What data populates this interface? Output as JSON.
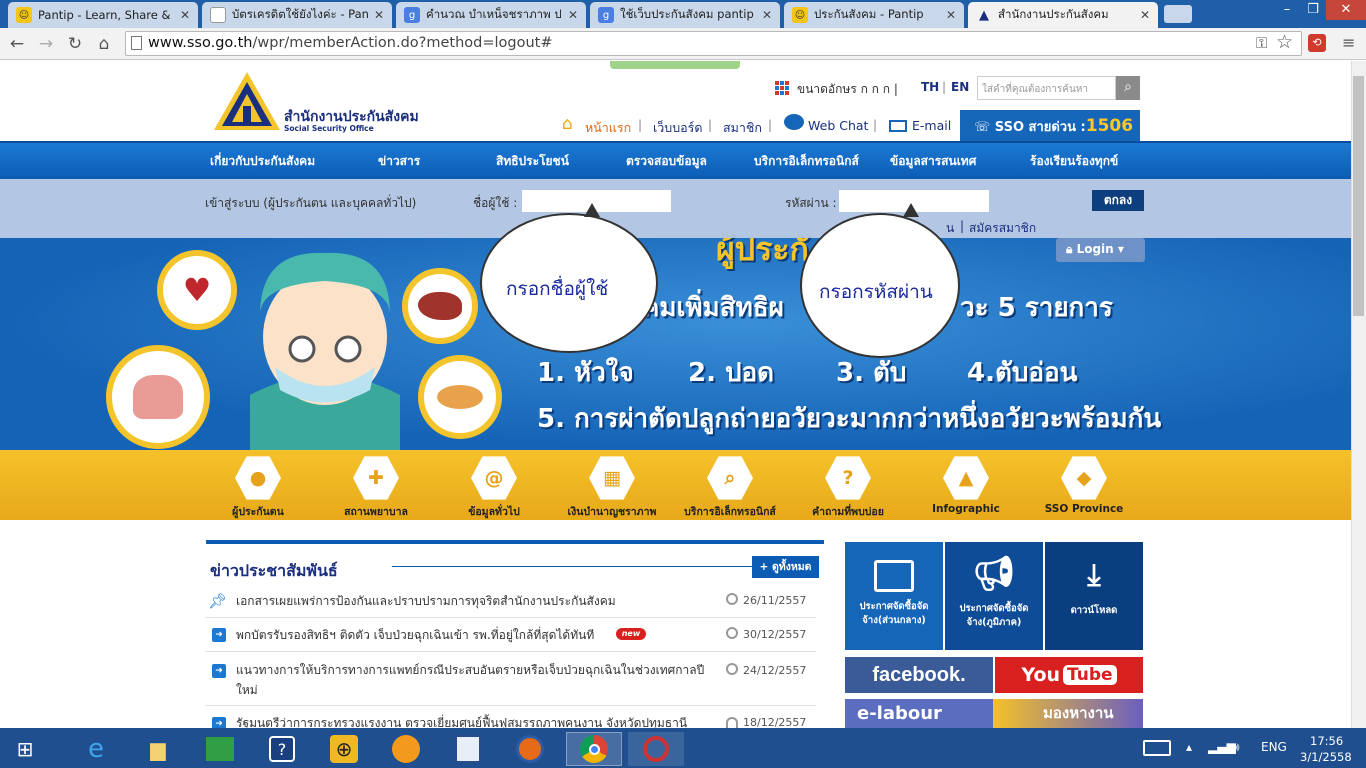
{
  "browser": {
    "tabs": [
      {
        "title": "Pantip - Learn, Share & Fu",
        "favicon": "pantip-smiley-icon"
      },
      {
        "title": "บัตรเครดิตใช้ยังไงค่ะ - Pantip",
        "favicon": "page-icon"
      },
      {
        "title": "คำนวณ บำเหน็จชราภาพ ประกั",
        "favicon": "google-icon"
      },
      {
        "title": "ใช้เว็บประกันสังคม pantip - คั",
        "favicon": "google-icon"
      },
      {
        "title": "ประกันสังคม - Pantip",
        "favicon": "pantip-smiley-icon"
      },
      {
        "title": "สำนักงานประกันสังคม",
        "favicon": "sso-icon"
      }
    ],
    "url_domain": "www.sso.go.th",
    "url_path": "/wpr/memberAction.do?method=logout#"
  },
  "header": {
    "logo_th": "สำนักงานประกันสังคม",
    "logo_en": "Social Security Office",
    "font_size_label": "ขนาดอักษร ก ก ก |",
    "lang_th": "TH",
    "lang_en": "EN",
    "search_placeholder": "ใส่คำที่คุณต้องการค้นหา",
    "links": {
      "home": "หน้าแรก",
      "webboard": "เว็บบอร์ด",
      "member": "สมาชิก",
      "webchat": "Web Chat",
      "email": "E-mail"
    },
    "hotline_label": "SSO สายด่วน :",
    "hotline_number": "1506"
  },
  "nav": [
    "เกี่ยวกับประกันสังคม",
    "ข่าวสาร",
    "สิทธิประโยชน์",
    "ตรวจสอบข้อมูล",
    "บริการอิเล็กทรอนิกส์",
    "ข้อมูลสารสนเทศ",
    "ร้องเรียนร้องทุกข์"
  ],
  "login": {
    "title": "เข้าสู่ระบบ (ผู้ประกันตน และบุคคลทั่วไป)",
    "username_label": "ชื่อผู้ใช้ :",
    "password_label": "รหัสผ่าน :",
    "ok": "ตกลง",
    "forgot_suffix": "น",
    "register": "สมัครสมาชิก",
    "login_pill": "Login"
  },
  "banner": {
    "heading": "ผู้ประกั",
    "line1_left": "คมเพิ่มสิทธิผ",
    "line1_right": "วะ 5 รายการ",
    "items": [
      "1. หัวใจ",
      "2. ปอด",
      "3. ตับ",
      "4.ตับอ่อน"
    ],
    "line3": "5. การผ่าตัดปลูกถ่ายอวัยวะมากกว่าหนึ่งอวัยวะพร้อมกัน",
    "bubble_username": "กรอกชื่อผู้ใช้",
    "bubble_password": "กรอกรหัสผ่าน"
  },
  "quick_icons": [
    {
      "label": "ผู้ประกันตน",
      "icon": "person-icon"
    },
    {
      "label": "สถานพยาบาล",
      "icon": "plus-icon"
    },
    {
      "label": "ข้อมูลทั่วไป",
      "icon": "at-icon"
    },
    {
      "label": "เงินบำนาญชราภาพ",
      "icon": "calculator-icon"
    },
    {
      "label": "บริการอิเล็กทรอนิกส์",
      "icon": "search-icon"
    },
    {
      "label": "คำถามที่พบบ่อย",
      "icon": "question-icon"
    },
    {
      "label": "Infographic",
      "icon": "infographic-icon"
    },
    {
      "label": "SSO Province",
      "icon": "map-icon"
    }
  ],
  "news": {
    "title": "ข่าวประชาสัมพันธ์",
    "view_all": "+ ดูทั้งหมด",
    "items": [
      {
        "text": "เอกสารเผยแพร่การป้องกันและปราบปรามการทุจริตสำนักงานประกันสังคม",
        "date": "26/11/2557"
      },
      {
        "text": "พกบัตรรับรองสิทธิฯ ติดตัว เจ็บป่วยฉุกเฉินเข้า รพ.ที่อยู่ใกล้ที่สุดได้ทันที",
        "date": "30/12/2557",
        "badge": "new"
      },
      {
        "text": "แนวทางการให้บริการทางการแพทย์กรณีประสบอันตรายหรือเจ็บป่วยฉุกเฉินในช่วงเทศกาลปีใหม่",
        "date": "24/12/2557"
      },
      {
        "text": "รัฐมนตรีว่าการกระทรวงแรงงาน ตรวจเยี่ยมศูนย์ฟื้นฟูสมรรถภาพคนงาน จังหวัดปทุมธานี",
        "date": "18/12/2557"
      }
    ]
  },
  "tiles": [
    {
      "label": "ประกาศจัดซื้อจัดจ้าง(ส่วนกลาง)",
      "icon": "id-card-icon"
    },
    {
      "label": "ประกาศจัดซื้อจัดจ้าง(ภูมิภาค)",
      "icon": "megaphone-icon"
    },
    {
      "label": "ดาวน์โหลด",
      "icon": "download-icon"
    }
  ],
  "social": {
    "facebook": "facebook.",
    "youtube_you": "You",
    "youtube_tube": "Tube",
    "elabour": "e-labour",
    "job": "มองหางาน"
  },
  "taskbar": {
    "lang": "ENG",
    "time": "17:56",
    "date": "3/1/2558"
  }
}
